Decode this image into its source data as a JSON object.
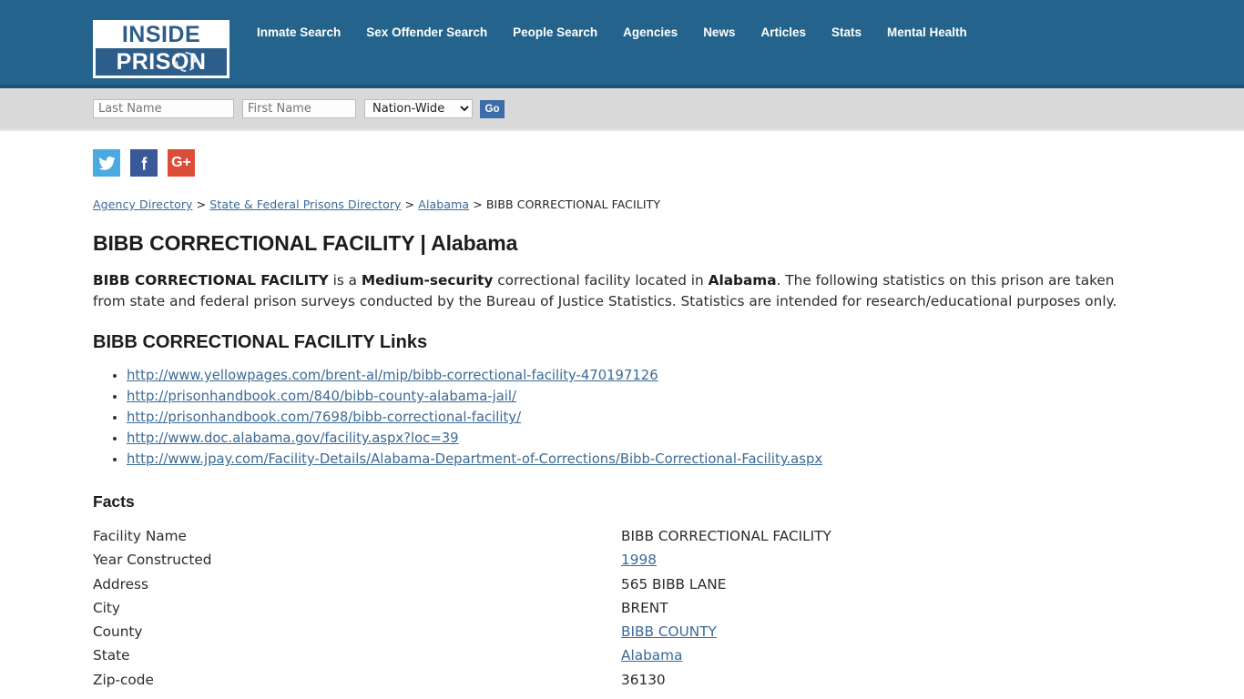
{
  "header": {
    "logo": {
      "line1": "INSIDE",
      "line2": "PRISON"
    },
    "nav": [
      {
        "label": "Inmate Search"
      },
      {
        "label": "Sex Offender Search"
      },
      {
        "label": "People Search"
      },
      {
        "label": "Agencies"
      },
      {
        "label": "News"
      },
      {
        "label": "Articles"
      },
      {
        "label": "Stats"
      },
      {
        "label": "Mental Health"
      }
    ],
    "bg_color": "#24648c"
  },
  "search": {
    "last_name_placeholder": "Last Name",
    "last_name_value": "",
    "first_name_placeholder": "First Name",
    "first_name_value": "",
    "scope_selected": "Nation-Wide",
    "scope_options": [
      "Nation-Wide"
    ],
    "go_label": "Go",
    "go_color": "#3b6ea8"
  },
  "social": [
    {
      "name": "twitter",
      "color": "#4aa9e0"
    },
    {
      "name": "facebook",
      "color": "#3b5998"
    },
    {
      "name": "googleplus",
      "color": "#dd4b39",
      "label": "G+"
    }
  ],
  "breadcrumb": {
    "items": [
      {
        "label": "Agency Directory",
        "link": true
      },
      {
        "label": "State & Federal Prisons Directory",
        "link": true
      },
      {
        "label": "Alabama",
        "link": true
      },
      {
        "label": "BIBB CORRECTIONAL FACILITY",
        "link": false
      }
    ],
    "separator": ">"
  },
  "main": {
    "title": "BIBB CORRECTIONAL FACILITY | Alabama",
    "intro": {
      "part1": "BIBB CORRECTIONAL FACILITY",
      "part2": " is a ",
      "part3": "Medium-security",
      "part4": " correctional facility located in ",
      "part5": "Alabama",
      "part6": ". The following statistics on this prison are taken from state and federal prison surveys conducted by the Bureau of Justice Statistics. Statistics are intended for research/educational purposes only."
    },
    "links_heading": "BIBB CORRECTIONAL FACILITY Links",
    "links": [
      {
        "label": "http://www.yellowpages.com/brent-al/mip/bibb-correctional-facility-470197126"
      },
      {
        "label": "http://prisonhandbook.com/840/bibb-county-alabama-jail/"
      },
      {
        "label": "http://prisonhandbook.com/7698/bibb-correctional-facility/"
      },
      {
        "label": "http://www.doc.alabama.gov/facility.aspx?loc=39"
      },
      {
        "label": "http://www.jpay.com/Facility-Details/Alabama-Department-of-Corrections/Bibb-Correctional-Facility.aspx"
      }
    ],
    "facts_heading": "Facts",
    "facts": [
      {
        "label": "Facility Name",
        "value": "BIBB CORRECTIONAL FACILITY",
        "link": false
      },
      {
        "label": "Year Constructed",
        "value": "1998",
        "link": true
      },
      {
        "label": "Address",
        "value": "565 BIBB LANE",
        "link": false
      },
      {
        "label": "City",
        "value": "BRENT",
        "link": false
      },
      {
        "label": "County",
        "value": "BIBB COUNTY",
        "link": true
      },
      {
        "label": "State",
        "value": "Alabama",
        "link": true
      },
      {
        "label": "Zip-code",
        "value": "36130",
        "link": false
      }
    ]
  },
  "colors": {
    "header_blue": "#24648c",
    "link_blue": "#3a6a96",
    "searchbar_gray": "#d9d9d9"
  }
}
